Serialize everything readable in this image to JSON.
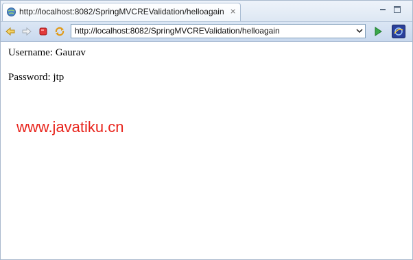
{
  "tab": {
    "title": "http://localhost:8082/SpringMVCREValidation/helloagain",
    "close_glyph": "⨯"
  },
  "toolbar": {
    "url": "http://localhost:8082/SpringMVCREValidation/helloagain",
    "icons": [
      "back-icon",
      "forward-icon",
      "stop-icon",
      "refresh-icon",
      "dropdown-icon",
      "go-icon",
      "browser-logo-icon"
    ]
  },
  "page": {
    "username_line": "Username: Gaurav",
    "password_line": "Password: jtp",
    "watermark": "www.javatiku.cn"
  },
  "colors": {
    "watermark": "#e8231b",
    "toolbar": "#c9d9ee",
    "tabbar": "#dde7f3"
  }
}
